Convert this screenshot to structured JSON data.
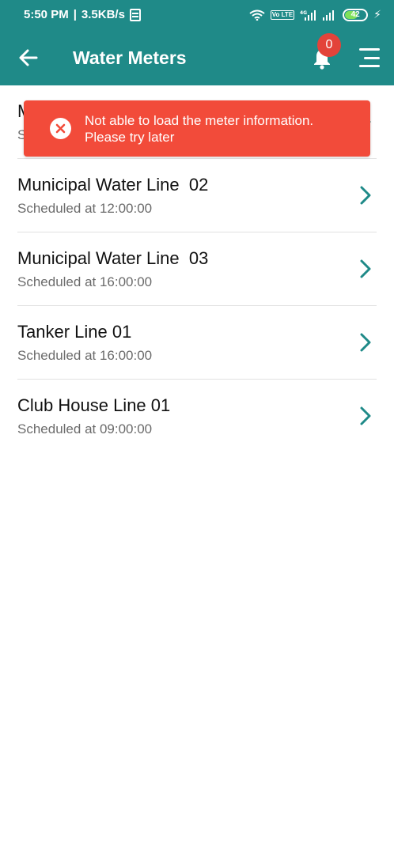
{
  "status_bar": {
    "time": "5:50 PM",
    "speed": "3.5KB/s",
    "battery": "42",
    "volte": "Vo LTE",
    "net": "4G"
  },
  "app_bar": {
    "title": "Water Meters",
    "notification_count": "0",
    "back_icon": "arrow-left-icon",
    "bell_icon": "bell-icon",
    "menu_icon": "hamburger-menu-icon"
  },
  "toast": {
    "message": "Not able to load the meter information. Please try later",
    "icon": "error-circle-x-icon",
    "color": "#f24b3a"
  },
  "meters": [
    {
      "name": "M",
      "schedule": "S"
    },
    {
      "name": "Municipal Water Line  02",
      "schedule": "Scheduled at 12:00:00"
    },
    {
      "name": "Municipal Water Line  03",
      "schedule": "Scheduled at 16:00:00"
    },
    {
      "name": "Tanker Line 01",
      "schedule": "Scheduled at 16:00:00"
    },
    {
      "name": "Club House Line 01",
      "schedule": "Scheduled at 09:00:00"
    }
  ],
  "colors": {
    "primary": "#1f8a88",
    "badge": "#e3433a",
    "chevron": "#1f8a88"
  }
}
